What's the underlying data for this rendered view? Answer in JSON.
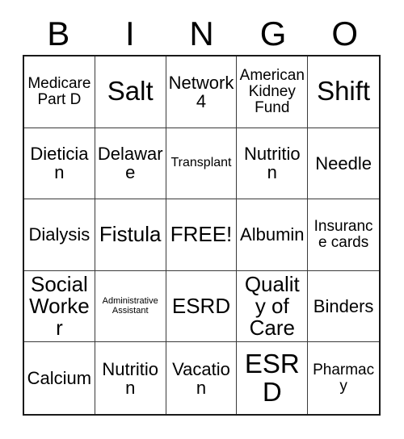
{
  "card": {
    "title_letters": [
      "B",
      "I",
      "N",
      "G",
      "O"
    ],
    "rows": [
      [
        {
          "text": "Medicare Part D",
          "size": "sm"
        },
        {
          "text": "Salt",
          "size": "xl"
        },
        {
          "text": "Network 4",
          "size": "md"
        },
        {
          "text": "American Kidney Fund",
          "size": "sm"
        },
        {
          "text": "Shift",
          "size": "xl"
        }
      ],
      [
        {
          "text": "Dietician",
          "size": "md"
        },
        {
          "text": "Delaware",
          "size": "md"
        },
        {
          "text": "Transplant",
          "size": "xs"
        },
        {
          "text": "Nutrition",
          "size": "md"
        },
        {
          "text": "Needle",
          "size": "md"
        }
      ],
      [
        {
          "text": "Dialysis",
          "size": "md"
        },
        {
          "text": "Fistula",
          "size": "lg"
        },
        {
          "text": "FREE!",
          "size": "lg"
        },
        {
          "text": "Albumin",
          "size": "md"
        },
        {
          "text": "Insurance cards",
          "size": "sm"
        }
      ],
      [
        {
          "text": "Social Worker",
          "size": "lg"
        },
        {
          "text": "Administrative Assistant",
          "size": "xxs"
        },
        {
          "text": "ESRD",
          "size": "lg"
        },
        {
          "text": "Quality of Care",
          "size": "lg"
        },
        {
          "text": "Binders",
          "size": "md"
        }
      ],
      [
        {
          "text": "Calcium",
          "size": "md"
        },
        {
          "text": "Nutrition",
          "size": "md"
        },
        {
          "text": "Vacation",
          "size": "md"
        },
        {
          "text": "ESRD",
          "size": "xl"
        },
        {
          "text": "Pharmacy",
          "size": "sm"
        }
      ]
    ],
    "colors": {
      "background": "#ffffff",
      "text": "#000000",
      "outer_border": "#1a1a1a",
      "inner_border": "#3a3a3a"
    }
  }
}
